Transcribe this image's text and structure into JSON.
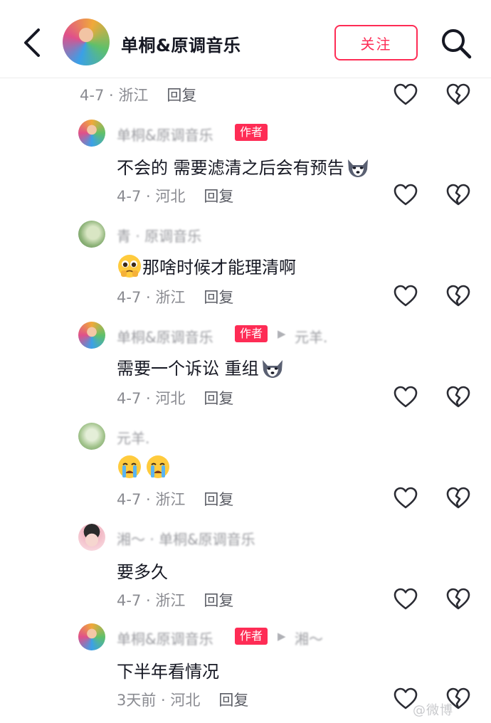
{
  "header": {
    "title": "单桐&原调音乐",
    "follow_label": "关注"
  },
  "top_meta": {
    "date_location": "4-7 · 浙江",
    "reply": "回复"
  },
  "comments": [
    {
      "name": "单桐&原调音乐",
      "author_tag": "作者",
      "reply_to": "",
      "text": "不会的  需要滤清之后会有预告",
      "emoji": "husky",
      "date_location": "4-7 · 河北",
      "reply": "回复"
    },
    {
      "name": "青    ·    原调音乐",
      "author_tag": "",
      "reply_to": "",
      "text": "那啥时候才能理清啊",
      "emoji": "pleading",
      "date_location": "4-7 · 浙江",
      "reply": "回复"
    },
    {
      "name": "单桐&原调音乐",
      "author_tag": "作者",
      "reply_to": "元羊.",
      "text": "需要一个诉讼  重组",
      "emoji": "husky",
      "date_location": "4-7 · 河北",
      "reply": "回复"
    },
    {
      "name": "元羊.",
      "author_tag": "",
      "reply_to": "",
      "text": "",
      "emoji": "crying",
      "date_location": "4-7 · 浙江",
      "reply": "回复"
    },
    {
      "name": "湘～   ·  单桐&原调音乐",
      "author_tag": "",
      "reply_to": "",
      "text": "要多久",
      "emoji": "",
      "date_location": "4-7 · 浙江",
      "reply": "回复"
    },
    {
      "name": "单桐&原调音乐",
      "author_tag": "作者",
      "reply_to": "湘～",
      "text": "下半年看情况",
      "emoji": "",
      "date_location": "3天前 · 河北",
      "reply": "回复"
    }
  ],
  "icons": {
    "like": "heart-outline-icon",
    "dislike": "broken-heart-icon",
    "back": "chevron-left-icon",
    "search": "search-icon"
  },
  "colors": {
    "accent": "#fe2c55",
    "meta_text": "#8a8b91",
    "body_text": "#161823"
  },
  "watermark": "@微博"
}
